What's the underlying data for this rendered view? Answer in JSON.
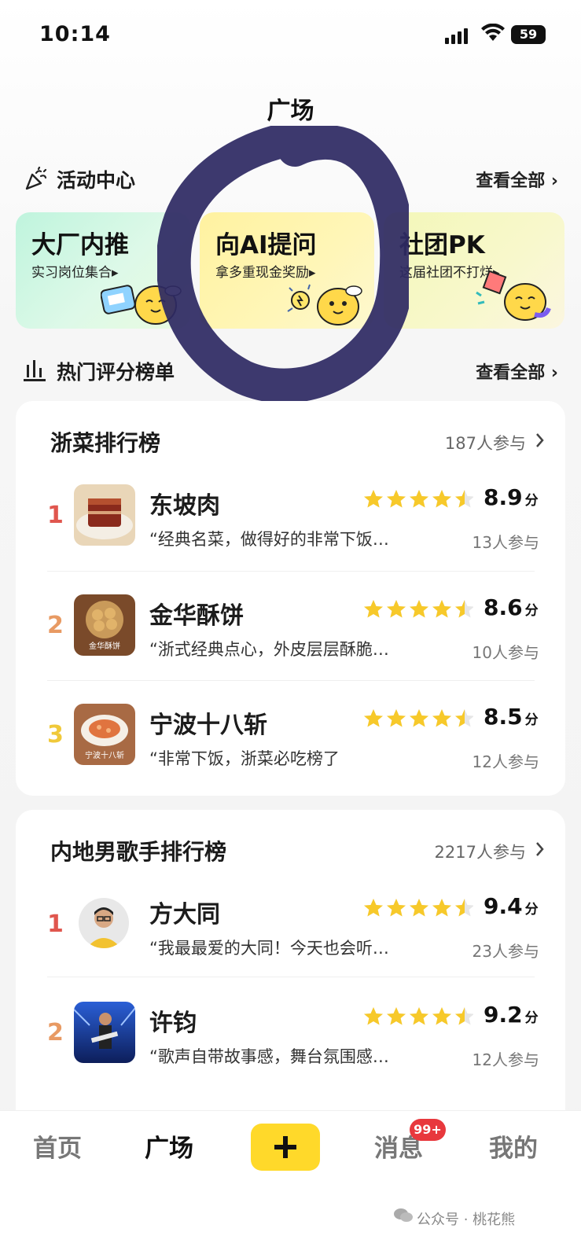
{
  "status_bar": {
    "time": "10:14",
    "battery": "59"
  },
  "page_title": "广场",
  "activity_section": {
    "title": "活动中心",
    "view_all": "查看全部 ›",
    "cards": [
      {
        "title": "大厂内推",
        "subtitle": "实习岗位集合▸"
      },
      {
        "title": "向AI提问",
        "subtitle": "拿多重现金奖励▸"
      },
      {
        "title": "社团PK",
        "subtitle": "这届社团不打烊▸"
      }
    ]
  },
  "hot_section": {
    "title": "热门评分榜单",
    "view_all": "查看全部 ›"
  },
  "rankings": [
    {
      "title": "浙菜排行榜",
      "participants": "187人参与",
      "items": [
        {
          "rank": "1",
          "name": "东坡肉",
          "quote": "“经典名菜，做得好的非常下饭…",
          "score": "8.9",
          "unit": "分",
          "participants": "13人参与",
          "stars": 4.5
        },
        {
          "rank": "2",
          "name": "金华酥饼",
          "quote": "“浙式经典点心，外皮层层酥脆…",
          "score": "8.6",
          "unit": "分",
          "participants": "10人参与",
          "stars": 4.5,
          "thumb_text": "金华酥饼"
        },
        {
          "rank": "3",
          "name": "宁波十八斩",
          "quote": "“非常下饭，浙菜必吃榜了",
          "score": "8.5",
          "unit": "分",
          "participants": "12人参与",
          "stars": 4.5,
          "thumb_text": "宁波十八斩"
        }
      ]
    },
    {
      "title": "内地男歌手排行榜",
      "participants": "2217人参与",
      "items": [
        {
          "rank": "1",
          "name": "方大同",
          "quote": "“我最最爱的大同！今天也会听…",
          "score": "9.4",
          "unit": "分",
          "participants": "23人参与",
          "stars": 4.5
        },
        {
          "rank": "2",
          "name": "许钧",
          "quote": "“歌声自带故事感，舞台氛围感…",
          "score": "9.2",
          "unit": "分",
          "participants": "12人参与",
          "stars": 4.5
        }
      ]
    }
  ],
  "nav": {
    "home": "首页",
    "square": "广场",
    "messages": "消息",
    "messages_badge": "99+",
    "mine": "我的"
  },
  "watermark": "公众号 · 桃花熊",
  "colors": {
    "accent": "#ffd92a",
    "rank1": "#e0564e",
    "rank2": "#e89a63",
    "rank3": "#f0c93a",
    "star": "#f7c92a",
    "badge": "#e8383d"
  }
}
